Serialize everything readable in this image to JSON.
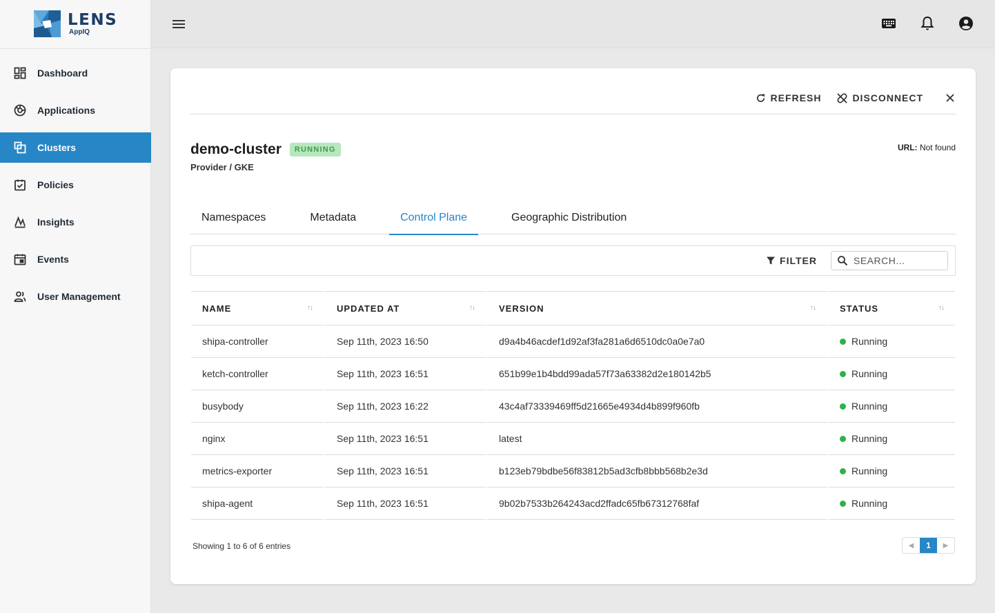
{
  "logo": {
    "word": "LENS",
    "sub": "AppIQ"
  },
  "sidebar": {
    "items": [
      {
        "label": "Dashboard",
        "icon": "dashboard-icon"
      },
      {
        "label": "Applications",
        "icon": "applications-icon"
      },
      {
        "label": "Clusters",
        "icon": "clusters-icon",
        "active": true
      },
      {
        "label": "Policies",
        "icon": "policies-icon"
      },
      {
        "label": "Insights",
        "icon": "insights-icon"
      },
      {
        "label": "Events",
        "icon": "events-icon"
      },
      {
        "label": "User Management",
        "icon": "user-management-icon"
      }
    ]
  },
  "topbar": {
    "icons": [
      "menu-icon",
      "keyboard-icon",
      "bell-icon",
      "account-icon"
    ]
  },
  "card": {
    "refresh_label": "REFRESH",
    "disconnect_label": "DISCONNECT",
    "cluster_name": "demo-cluster",
    "status": "RUNNING",
    "provider": "Provider / GKE",
    "url_label": "URL:",
    "url_value": "Not found"
  },
  "tabs": [
    {
      "label": "Namespaces"
    },
    {
      "label": "Metadata"
    },
    {
      "label": "Control Plane",
      "active": true
    },
    {
      "label": "Geographic Distribution"
    }
  ],
  "toolbar": {
    "filter_label": "FILTER",
    "search_placeholder": "SEARCH..."
  },
  "table": {
    "columns": [
      "NAME",
      "UPDATED AT",
      "VERSION",
      "STATUS"
    ],
    "rows": [
      {
        "name": "shipa-controller",
        "updated": "Sep 11th, 2023 16:50",
        "version": "d9a4b46acdef1d92af3fa281a6d6510dc0a0e7a0",
        "status": "Running"
      },
      {
        "name": "ketch-controller",
        "updated": "Sep 11th, 2023 16:51",
        "version": "651b99e1b4bdd99ada57f73a63382d2e180142b5",
        "status": "Running"
      },
      {
        "name": "busybody",
        "updated": "Sep 11th, 2023 16:22",
        "version": "43c4af73339469ff5d21665e4934d4b899f960fb",
        "status": "Running"
      },
      {
        "name": "nginx",
        "updated": "Sep 11th, 2023 16:51",
        "version": "latest",
        "status": "Running"
      },
      {
        "name": "metrics-exporter",
        "updated": "Sep 11th, 2023 16:51",
        "version": "b123eb79bdbe56f83812b5ad3cfb8bbb568b2e3d",
        "status": "Running"
      },
      {
        "name": "shipa-agent",
        "updated": "Sep 11th, 2023 16:51",
        "version": "9b02b7533b264243acd2ffadc65fb67312768faf",
        "status": "Running"
      }
    ]
  },
  "footer": {
    "entries_text": "Showing 1 to 6 of 6 entries",
    "page": "1"
  },
  "colors": {
    "accent": "#2686c6",
    "running_dot": "#2bb24c",
    "pill_bg": "#b7e7bd"
  }
}
